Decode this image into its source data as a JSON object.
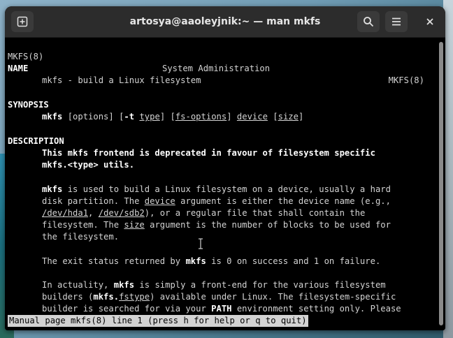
{
  "window": {
    "title": "artosya@aaoleyjnik:~ — man mkfs",
    "buttons": {
      "new_tab": "plus-icon",
      "search": "search-icon",
      "menu": "hamburger-menu-icon",
      "close": "close-icon"
    }
  },
  "man": {
    "header_left": "MKFS(8)",
    "header_center": "System Administration",
    "header_right": "MKFS(8)",
    "name_heading": "NAME",
    "name_text": "mkfs - build a Linux filesystem",
    "synopsis_heading": "SYNOPSIS",
    "synopsis": {
      "cmd": "mkfs",
      "options": " [options] [",
      "flag_t": "-t",
      "sp1": " ",
      "type": "type",
      "close1": "] [",
      "fs_options": "fs-options",
      "close2": "] ",
      "device": "device",
      "sp2": " [",
      "size": "size",
      "close3": "]"
    },
    "description_heading": "DESCRIPTION",
    "desc_bold_1": "This mkfs frontend is deprecated in favour of filesystem specific",
    "desc_bold_2": "mkfs.<type> utils.",
    "p1": {
      "l1_cmd": "mkfs",
      "l1_rest": " is used to build a Linux filesystem on a device, usually a hard",
      "l2_a": "disk partition. The ",
      "l2_device": "device",
      "l2_b": " argument is either the device name (e.g.,",
      "l3_hda1": "/dev/hda1",
      "l3_a": ", ",
      "l3_sdb2": "/dev/sdb2",
      "l3_b": "), or a regular file that shall contain the",
      "l4_a": "filesystem. The ",
      "l4_size": "size",
      "l4_b": " argument is the number of blocks to be used for",
      "l5": "the filesystem."
    },
    "p2": {
      "a": "The exit status returned by ",
      "cmd": "mkfs",
      "b": " is 0 on success and 1 on failure."
    },
    "p3": {
      "l1_a": "In actuality, ",
      "l1_cmd": "mkfs",
      "l1_b": " is simply a front-end for the various filesystem",
      "l2_a": "builders (",
      "l2_cmd": "mkfs.",
      "l2_fstype": "fstype",
      "l2_b": ") available under Linux. The filesystem-specific",
      "l3_a": "builder is searched for via your ",
      "l3_path": "PATH",
      "l3_b": " environment setting only. Please"
    },
    "status_line": "Manual page mkfs(8) line 1 (press h for help or q to quit)"
  }
}
